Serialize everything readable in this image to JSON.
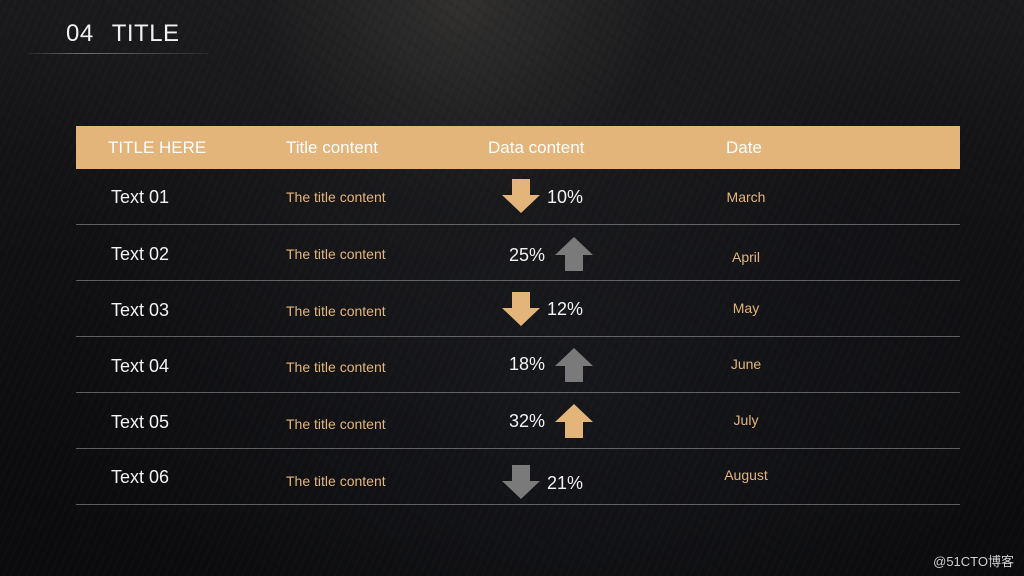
{
  "slide": {
    "number": "04",
    "title": "TITLE"
  },
  "table": {
    "headers": [
      "TITLE HERE",
      "Title content",
      "Data content",
      "Date"
    ],
    "rows": [
      {
        "name": "Text 01",
        "title": "The title content",
        "value": "10%",
        "trend": "down",
        "arrow_color": "#e4b57a",
        "date": "March"
      },
      {
        "name": "Text 02",
        "title": "The title content",
        "value": "25%",
        "trend": "up",
        "arrow_color": "#7a7a7a",
        "date": "April"
      },
      {
        "name": "Text 03",
        "title": "The title content",
        "value": "12%",
        "trend": "down",
        "arrow_color": "#e4b57a",
        "date": "May"
      },
      {
        "name": "Text 04",
        "title": "The title content",
        "value": "18%",
        "trend": "up",
        "arrow_color": "#7a7a7a",
        "date": "June"
      },
      {
        "name": "Text 05",
        "title": "The title content",
        "value": "32%",
        "trend": "up",
        "arrow_color": "#e4b57a",
        "date": "July"
      },
      {
        "name": "Text 06",
        "title": "The title content",
        "value": "21%",
        "trend": "down",
        "arrow_color": "#7a7a7a",
        "date": "August"
      }
    ]
  },
  "colors": {
    "accent": "#e4b57a",
    "neutral_arrow": "#7a7a7a",
    "background": "#111114"
  },
  "icons": {
    "down": "arrow-down-icon",
    "up": "arrow-up-icon"
  },
  "watermark": "@51CTO博客"
}
